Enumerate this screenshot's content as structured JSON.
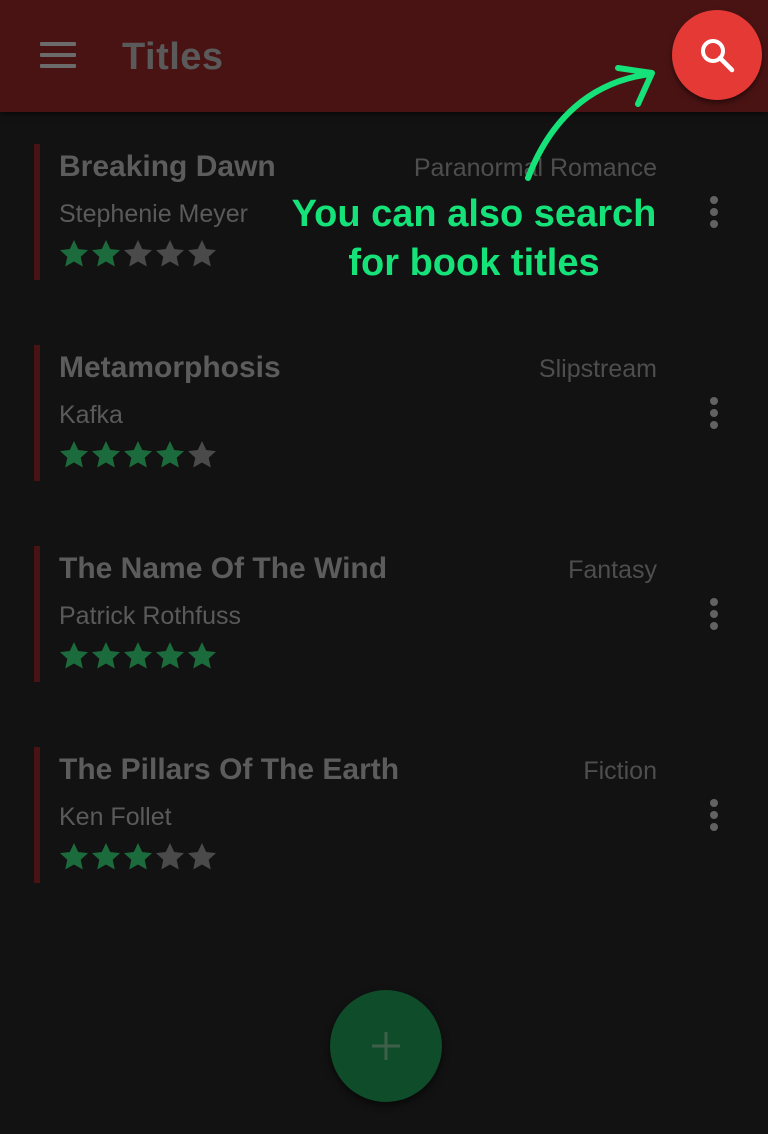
{
  "app_bar": {
    "title": "Titles",
    "menu_icon": "hamburger-menu-icon",
    "search_icon": "search-icon",
    "background": "#4a1313"
  },
  "books": [
    {
      "title": "Breaking Dawn",
      "genre": "Paranormal Romance",
      "author": "Stephenie Meyer",
      "rating": 2,
      "max_rating": 5
    },
    {
      "title": "Metamorphosis",
      "genre": "Slipstream",
      "author": "Kafka",
      "rating": 4,
      "max_rating": 5
    },
    {
      "title": "The Name Of The Wind",
      "genre": "Fantasy",
      "author": "Patrick Rothfuss",
      "rating": 5,
      "max_rating": 5
    },
    {
      "title": "The Pillars Of The Earth",
      "genre": "Fiction",
      "author": "Ken Follet",
      "rating": 3,
      "max_rating": 5
    }
  ],
  "add_button": {
    "icon": "plus-icon"
  },
  "coach_mark": {
    "line1": "You can also search",
    "line2": "for book titles"
  },
  "colors": {
    "accent": "#4a1313",
    "search_fab": "#e53935",
    "add_fab": "#0f4c29",
    "star_filled": "#1b6b3c",
    "star_empty": "#4a4a4a",
    "coach": "#16e27a"
  }
}
